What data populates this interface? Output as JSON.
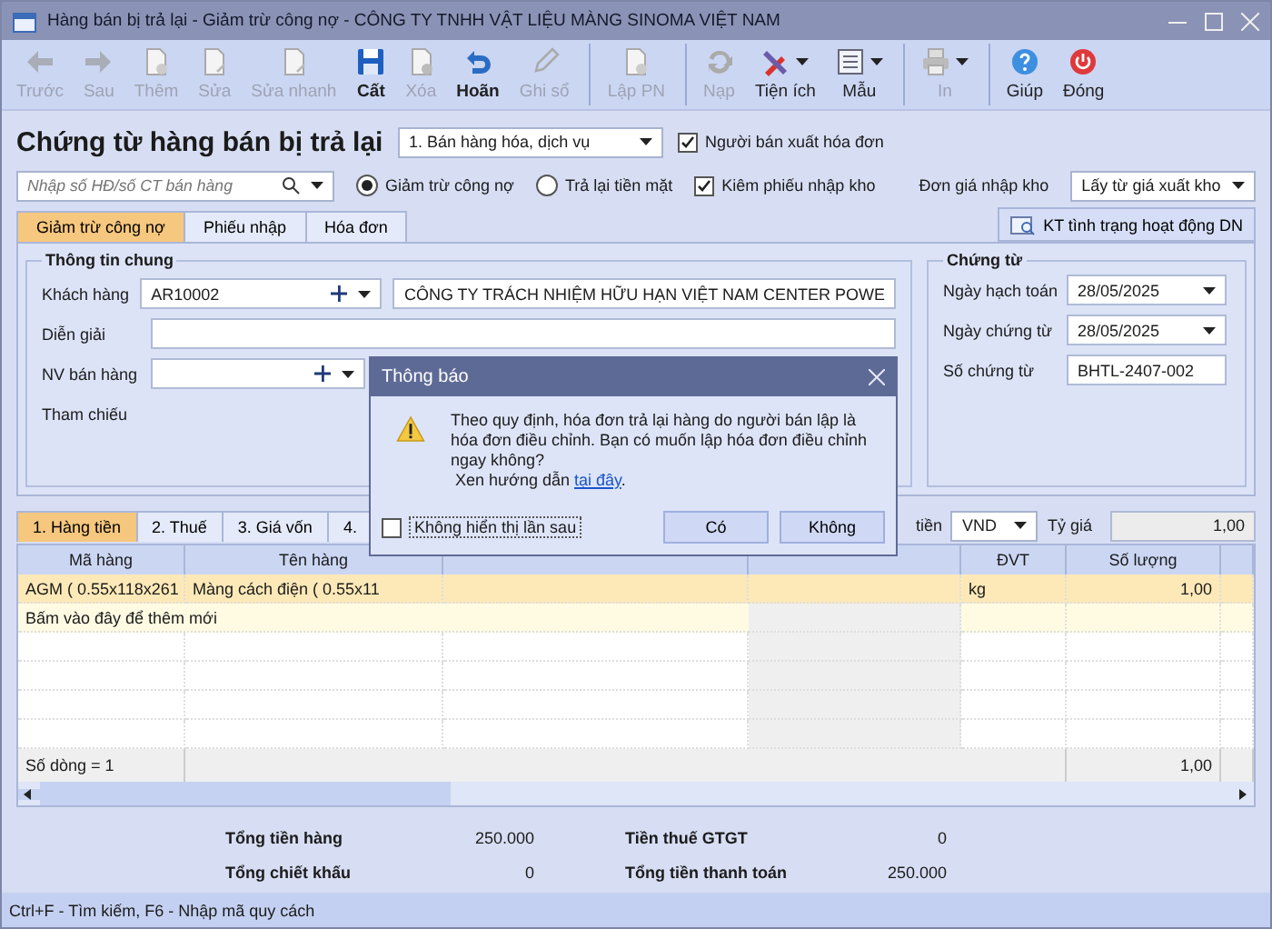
{
  "window": {
    "title": "Hàng bán bị trả lại - Giảm trừ công nợ - CÔNG TY TNHH VẬT LIỆU MÀNG SINOMA VIỆT NAM"
  },
  "toolbar": [
    {
      "label": "Trước",
      "disabled": true,
      "dropdown": false,
      "separator": false
    },
    {
      "label": "Sau",
      "disabled": true,
      "dropdown": false,
      "separator": false
    },
    {
      "label": "Thêm",
      "disabled": true,
      "dropdown": false,
      "separator": false
    },
    {
      "label": "Sửa",
      "disabled": true,
      "dropdown": false,
      "separator": false
    },
    {
      "label": "Sửa nhanh",
      "disabled": true,
      "dropdown": false,
      "separator": false
    },
    {
      "label": "Cất",
      "disabled": false,
      "dropdown": false,
      "separator": false
    },
    {
      "label": "Xóa",
      "disabled": true,
      "dropdown": false,
      "separator": false
    },
    {
      "label": "Hoãn",
      "disabled": false,
      "dropdown": false,
      "separator": false
    },
    {
      "label": "Ghi sổ",
      "disabled": true,
      "dropdown": false,
      "separator": false
    },
    {
      "label": "Lập PN",
      "disabled": true,
      "dropdown": false,
      "separator": true
    },
    {
      "label": "Nạp",
      "disabled": true,
      "dropdown": false,
      "separator": true
    },
    {
      "label": "Tiện ích",
      "disabled": false,
      "dropdown": true,
      "separator": false
    },
    {
      "label": "Mẫu",
      "disabled": false,
      "dropdown": true,
      "separator": false
    },
    {
      "label": "In",
      "disabled": true,
      "dropdown": true,
      "separator": true
    },
    {
      "label": "Giúp",
      "disabled": false,
      "dropdown": false,
      "separator": true
    },
    {
      "label": "Đóng",
      "disabled": false,
      "dropdown": false,
      "separator": false
    }
  ],
  "form": {
    "title": "Chứng từ hàng bán bị trả lại",
    "type_select": "1. Bán hàng hóa, dịch vụ",
    "seller_invoice": {
      "label": "Người bán xuất hóa đơn",
      "checked": true
    },
    "search": {
      "placeholder": "Nhập số HĐ/số CT bán hàng"
    },
    "modes": [
      {
        "label": "Giảm trừ công nợ",
        "selected": true
      },
      {
        "label": "Trả lại tiền mặt",
        "selected": false
      }
    ],
    "with_receipt": {
      "label": "Kiêm phiếu nhập kho",
      "checked": true
    },
    "unit_price": {
      "label": "Đơn giá nhập kho",
      "value": "Lấy từ giá xuất kho"
    }
  },
  "tabs": [
    {
      "label": "Giảm trừ công nợ",
      "selected": true
    },
    {
      "label": "Phiếu nhập",
      "selected": false
    },
    {
      "label": "Hóa đơn",
      "selected": false
    }
  ],
  "check_button": {
    "label": "KT tình trạng hoạt động DN"
  },
  "general": {
    "title": "Thông tin chung",
    "fields": [
      {
        "kind": "lookup",
        "label": "Khách hàng",
        "value": "AR10002",
        "extra_value": "CÔNG TY TRÁCH NHIỆM HỮU HẠN VIỆT NAM CENTER POWE"
      },
      {
        "kind": "text",
        "label": "Diễn giải"
      },
      {
        "kind": "lookup",
        "label": "NV bán hàng"
      },
      {
        "kind": "label",
        "label": "Tham chiếu"
      }
    ]
  },
  "document": {
    "title": "Chứng từ",
    "fields": [
      {
        "kind": "date",
        "label": "Ngày hạch toán",
        "value": "28/05/2025"
      },
      {
        "kind": "date",
        "label": "Ngày chứng từ",
        "value": "28/05/2025"
      },
      {
        "kind": "text",
        "label": "Số chứng từ",
        "value": "BHTL-2407-002"
      }
    ]
  },
  "grid_tabs": [
    {
      "label": "1. Hàng tiền",
      "selected": true
    },
    {
      "label": "2. Thuế",
      "selected": false
    },
    {
      "label": "3. Giá vốn",
      "selected": false
    },
    {
      "label": "4.",
      "selected": false
    }
  ],
  "currency": {
    "label": "tiền",
    "value": "VND"
  },
  "rate": {
    "label": "Tỷ giá",
    "value": "1,00"
  },
  "grid": {
    "columns": [
      "Mã hàng",
      "Tên hàng",
      "ĐVT",
      "Số lượng"
    ],
    "rows": [
      {
        "selected": true,
        "cells": [
          "AGM ( 0.55x118x261",
          "Màng cách điện ( 0.55x11",
          "kg",
          "1,00"
        ]
      }
    ],
    "new_row": "Bấm vào đây để thêm mới",
    "footer": {
      "count": "Số dòng = 1",
      "quantity": "1,00"
    }
  },
  "totals": [
    {
      "label": "Tổng tiền hàng",
      "value": "250.000"
    },
    {
      "label": "Tiền thuế GTGT",
      "value": "0"
    },
    {
      "label": "Tổng chiết khấu",
      "value": "0"
    },
    {
      "label": "Tổng tiền thanh toán",
      "value": "250.000"
    }
  ],
  "status_bar": "Ctrl+F - Tìm kiếm, F6 - Nhập mã quy cách",
  "dialog": {
    "title": "Thông báo",
    "message": "Theo quy định, hóa đơn trả lại hàng do người bán lập là hóa đơn điều chỉnh. Bạn có muốn lập hóa đơn điều chỉnh ngay không?",
    "guide": "Xen hướng dẫn",
    "link": "tại đây",
    "guide_end": ".",
    "dont_show": {
      "label": "Không hiển thị lần sau",
      "checked": false
    },
    "buttons": [
      "Có",
      "Không"
    ]
  }
}
